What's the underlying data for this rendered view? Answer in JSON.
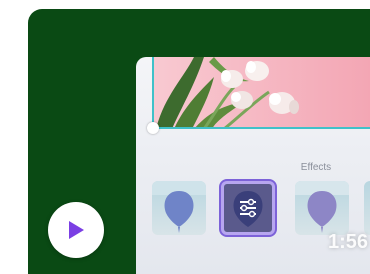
{
  "player": {
    "timestamp": "1:56",
    "play_icon": "play-icon"
  },
  "effects_panel": {
    "title": "Effects",
    "items": [
      {
        "icon": "balloon-icon",
        "selected": false
      },
      {
        "icon": "sliders-icon",
        "selected": true
      },
      {
        "icon": "balloon-icon",
        "selected": false
      },
      {
        "icon": "balloon-icon",
        "selected": false
      }
    ]
  },
  "colors": {
    "background": "#0a4a14",
    "accent": "#7c62d8",
    "selection_frame": "#3fc1c9",
    "play_triangle": "#7b3fe4"
  }
}
